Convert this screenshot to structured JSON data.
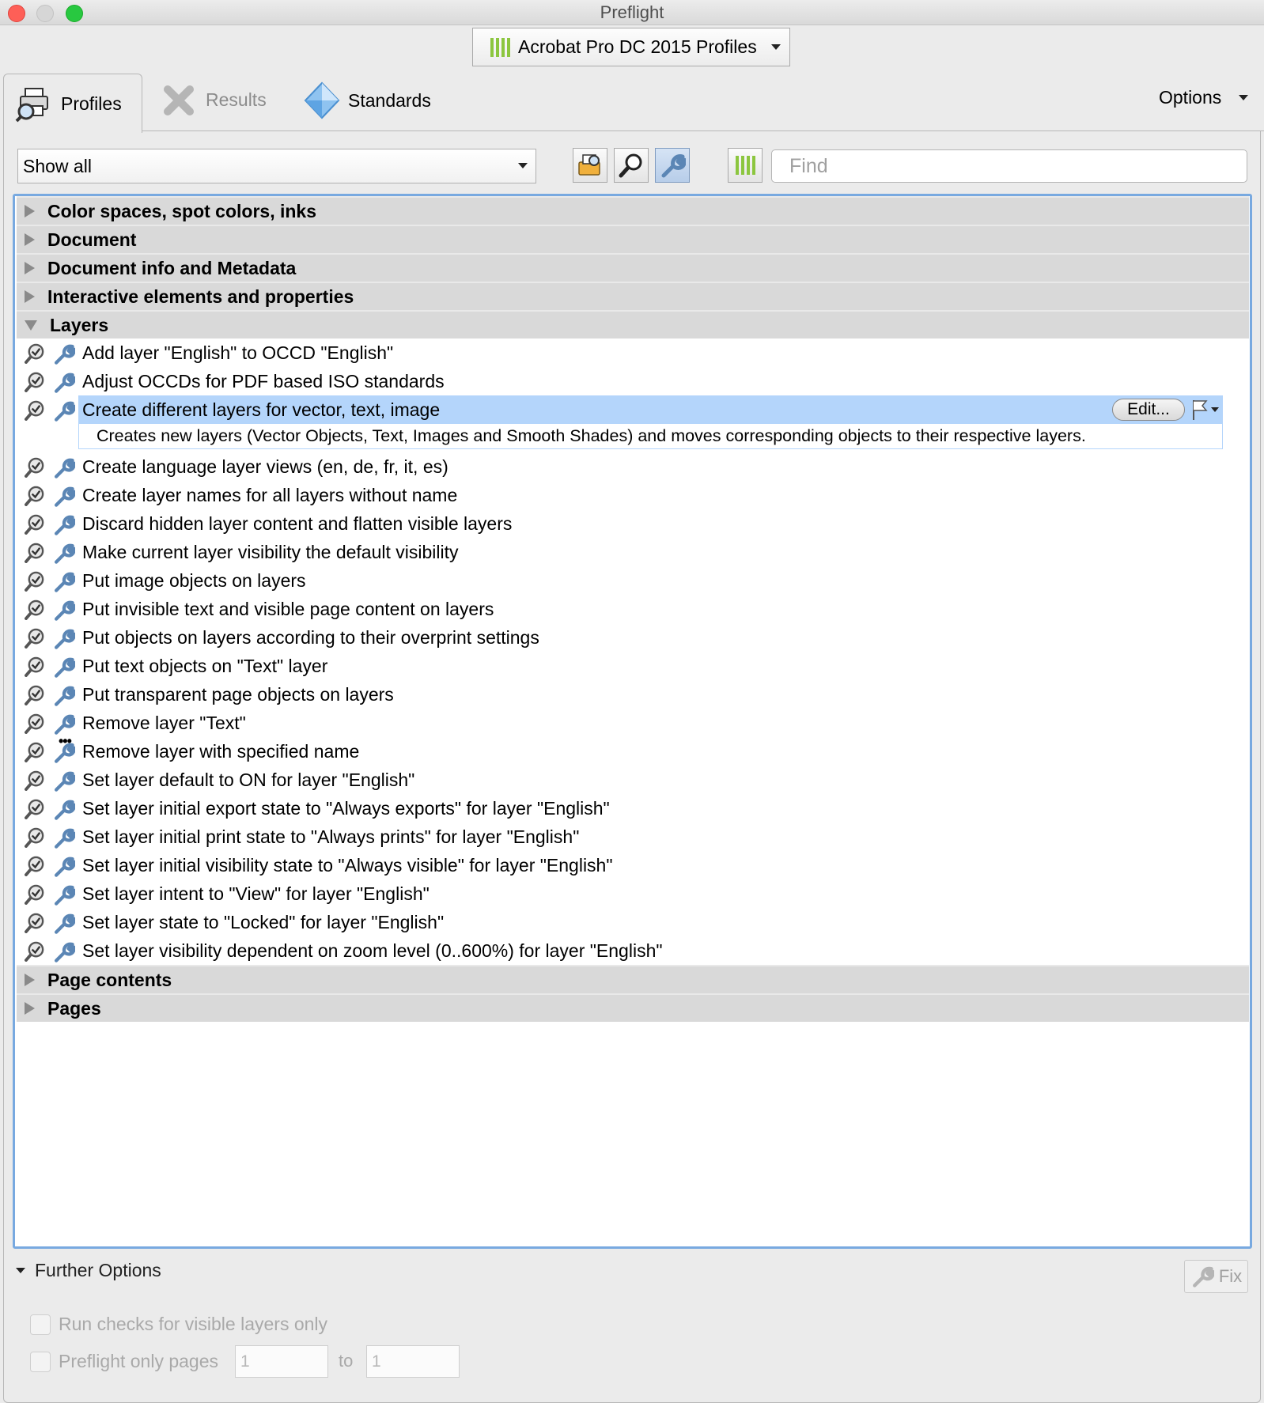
{
  "window": {
    "title": "Preflight"
  },
  "profile_selector": {
    "label": "Acrobat Pro DC 2015 Profiles"
  },
  "tabs": [
    {
      "label": "Profiles",
      "active": true
    },
    {
      "label": "Results",
      "active": false
    },
    {
      "label": "Standards",
      "active": false
    }
  ],
  "options": {
    "label": "Options"
  },
  "toolbar": {
    "filter_value": "Show all",
    "find_placeholder": "Find",
    "icons": [
      "profiles-filter-icon",
      "checks-filter-icon",
      "fixups-filter-icon",
      "libraries-icon"
    ]
  },
  "categories": {
    "color": "Color spaces, spot colors, inks",
    "document": "Document",
    "docinfo": "Document info and Metadata",
    "interactive": "Interactive elements and properties",
    "layers": "Layers",
    "page_contents": "Page contents",
    "pages": "Pages"
  },
  "layer_items": [
    "Add layer \"English\" to OCCD \"English\"",
    "Adjust OCCDs for PDF based ISO standards",
    "Create different layers for vector, text, image",
    "Create language layer views (en, de, fr, it, es)",
    "Create layer names for all layers without name",
    "Discard hidden layer content and flatten visible layers",
    "Make current layer visibility the default visibility",
    "Put image objects on layers",
    "Put invisible text and visible page content on layers",
    "Put objects on layers according to their overprint settings",
    "Put text objects on \"Text\" layer",
    "Put transparent page objects on layers",
    "Remove layer \"Text\"",
    "Remove layer with specified name",
    "Set layer default to ON for layer \"English\"",
    "Set layer initial export state to \"Always exports\" for layer \"English\"",
    "Set layer initial print state to \"Always prints\" for layer \"English\"",
    "Set layer initial visibility state to \"Always visible\" for layer \"English\"",
    "Set layer intent to \"View\" for layer \"English\"",
    "Set layer state to \"Locked\" for layer \"English\"",
    "Set layer visibility dependent on zoom level (0..600%) for layer \"English\""
  ],
  "selected": {
    "description": "Creates new layers (Vector Objects, Text, Images and Smooth Shades) and moves corresponding objects to their respective layers.",
    "edit_label": "Edit..."
  },
  "further_options": {
    "label": "Further Options",
    "fix_label": "Fix",
    "visible_layers_label": "Run checks for visible layers only",
    "pages_label": "Preflight only pages",
    "from_value": "1",
    "to_label": "to",
    "to_value": "1"
  },
  "colors": {
    "selection": "#b4d5fb",
    "focus_border": "#78a9e0",
    "accent_green": "#8cc63f"
  }
}
